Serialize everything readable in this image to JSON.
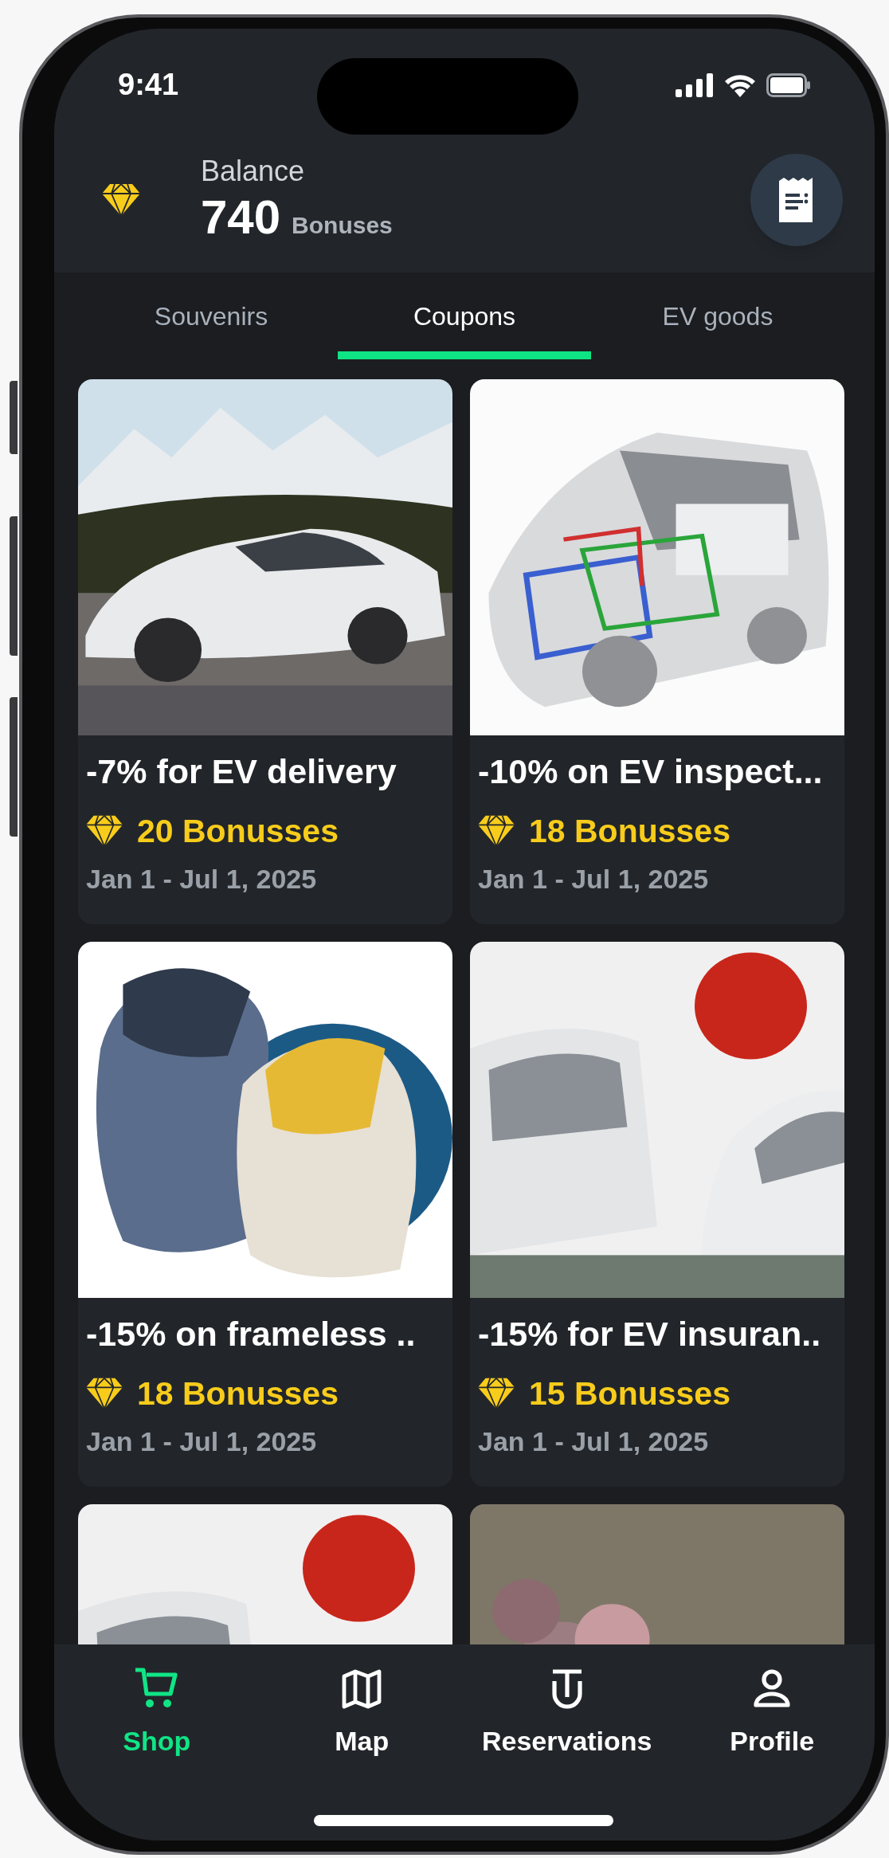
{
  "status_bar": {
    "time": "9:41"
  },
  "header": {
    "label": "Balance",
    "amount": "740",
    "unit": "Bonuses"
  },
  "tabs": [
    {
      "label": "Souvenirs",
      "selected": false
    },
    {
      "label": "Coupons",
      "selected": true
    },
    {
      "label": "EV goods",
      "selected": false
    }
  ],
  "cards": [
    {
      "kind": "picture",
      "title": "-7% for EV delivery",
      "price": "20 Bonusses",
      "dates": "Jan 1 - Jul 1, 2025"
    },
    {
      "kind": "picture",
      "title": "-10% on EV inspect...",
      "price": "18 Bonusses",
      "dates": "Jan 1 - Jul 1, 2025"
    },
    {
      "kind": "picture",
      "title": "-15% on frameless ..",
      "price": "18 Bonusses",
      "dates": "Jan 1 - Jul 1, 2025"
    },
    {
      "kind": "picture",
      "title": "-15% for EV insuran..",
      "price": "15 Bonusses",
      "dates": "Jan 1 - Jul 1, 2025"
    },
    {
      "kind": "picture"
    },
    {
      "kind": "picture"
    }
  ],
  "bottom_nav": [
    {
      "label": "Shop",
      "selected": true
    },
    {
      "label": "Map",
      "selected": false
    },
    {
      "label": "Reservations",
      "selected": false
    },
    {
      "label": "Profile",
      "selected": false
    }
  ]
}
